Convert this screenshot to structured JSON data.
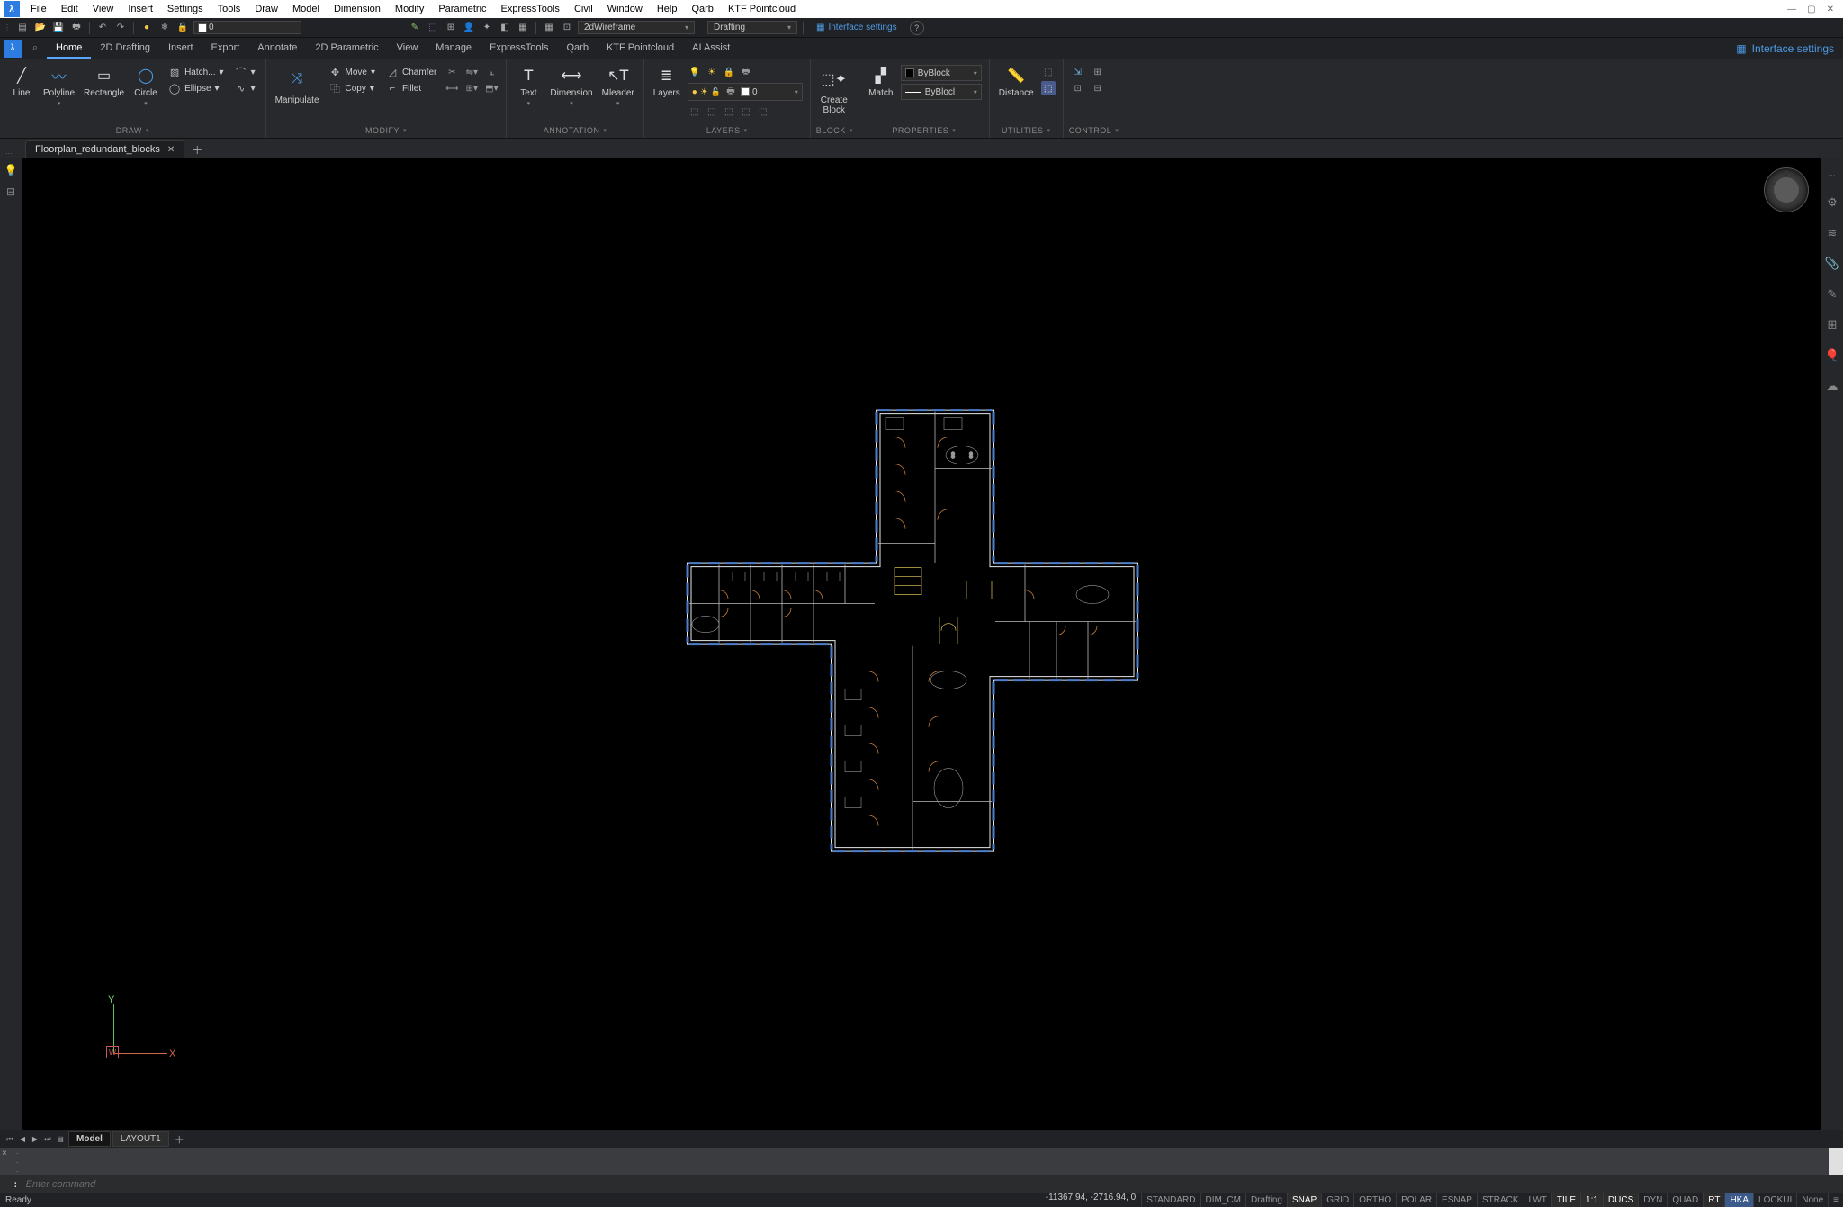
{
  "menubar": [
    "File",
    "Edit",
    "View",
    "Insert",
    "Settings",
    "Tools",
    "Draw",
    "Model",
    "Dimension",
    "Modify",
    "Parametric",
    "ExpressTools",
    "Civil",
    "Window",
    "Help",
    "Qarb",
    "KTF Pointcloud"
  ],
  "qat": {
    "layer_value": "0",
    "visual_style": "2dWireframe",
    "workspace": "Drafting",
    "settings_link": "Interface settings"
  },
  "tabs": [
    "Home",
    "2D Drafting",
    "Insert",
    "Export",
    "Annotate",
    "2D Parametric",
    "View",
    "Manage",
    "ExpressTools",
    "Qarb",
    "KTF Pointcloud",
    "AI Assist"
  ],
  "active_tab": "Home",
  "interface_settings_btn": "Interface settings",
  "ribbon": {
    "draw": {
      "title": "DRAW",
      "line": "Line",
      "polyline": "Polyline",
      "rectangle": "Rectangle",
      "circle": "Circle",
      "hatch": "Hatch...",
      "ellipse": "Ellipse"
    },
    "modify": {
      "title": "MODIFY",
      "manipulate": "Manipulate",
      "move": "Move",
      "copy": "Copy",
      "chamfer": "Chamfer",
      "fillet": "Fillet"
    },
    "annotation": {
      "title": "ANNOTATION",
      "text": "Text",
      "dimension": "Dimension",
      "mleader": "Mleader"
    },
    "layers": {
      "title": "LAYERS",
      "layers": "Layers",
      "layer_value": "0"
    },
    "block": {
      "title": "BLOCK",
      "create": "Create\nBlock"
    },
    "properties": {
      "title": "PROPERTIES",
      "match": "Match",
      "color": "ByBlock",
      "ltype": "ByBlocl"
    },
    "utilities": {
      "title": "UTILITIES",
      "distance": "Distance"
    },
    "control": {
      "title": "CONTROL"
    }
  },
  "document_tab": "Floorplan_redundant_blocks",
  "ucs": {
    "x": "X",
    "y": "Y",
    "w": "W"
  },
  "layout_tabs": {
    "model": "Model",
    "layout1": "LAYOUT1"
  },
  "command": {
    "prompt": ":",
    "placeholder": "Enter command"
  },
  "status": {
    "ready": "Ready",
    "coords": "-11367.94, -2716.94, 0",
    "std": "STANDARD",
    "dimstyle": "DIM_CM",
    "ws": "Drafting",
    "toggles": [
      "SNAP",
      "GRID",
      "ORTHO",
      "POLAR",
      "ESNAP",
      "STRACK",
      "LWT",
      "TILE",
      "1:1",
      "DUCS",
      "DYN",
      "QUAD",
      "RT",
      "HKA",
      "LOCKUI",
      "None"
    ],
    "on": [
      "SNAP",
      "TILE",
      "1:1",
      "DUCS",
      "RT",
      "HKA"
    ]
  }
}
